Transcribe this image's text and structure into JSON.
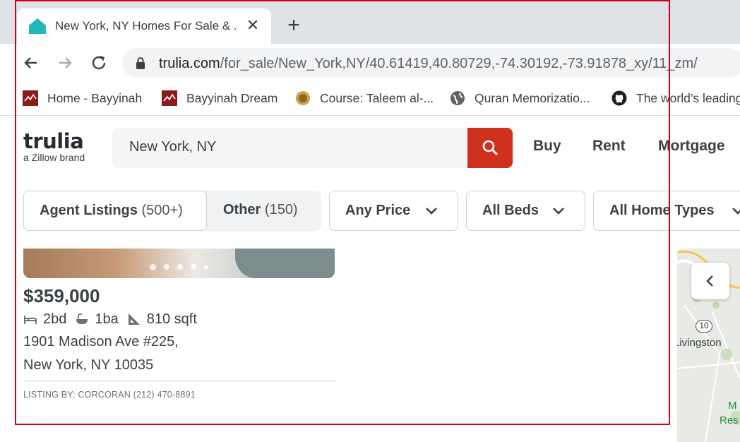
{
  "browser": {
    "tab_title": "New York, NY Homes For Sale & ...",
    "tab_close_icon": "close-icon",
    "new_tab_icon": "plus-icon",
    "url_domain": "trulia.com",
    "url_path": "/for_sale/New_York,NY/40.61419,40.80729,-74.30192,-73.91878_xy/11_zm/",
    "bookmarks": [
      {
        "label": "Home - Bayyinah",
        "icon": "bayyinah-icon"
      },
      {
        "label": "Bayyinah Dream",
        "icon": "bayyinah-icon"
      },
      {
        "label": "Course: Taleem al-...",
        "icon": "coin-icon"
      },
      {
        "label": "Quran Memorizatio...",
        "icon": "globe-icon"
      },
      {
        "label": "The world’s leading",
        "icon": "github-icon"
      }
    ]
  },
  "header": {
    "logo": "trulia",
    "logo_sub": "a Zillow brand",
    "search_value": "New York, NY",
    "nav": [
      "Buy",
      "Rent",
      "Mortgage"
    ]
  },
  "filters": {
    "agent_label": "Agent Listings",
    "agent_count": "(500+)",
    "other_label": "Other",
    "other_count": "(150)",
    "price": "Any Price",
    "beds": "All Beds",
    "home_types": "All Home Types"
  },
  "listing": {
    "price": "$359,000",
    "beds": "2bd",
    "baths": "1ba",
    "sqft": "810 sqft",
    "address_line1": "1901 Madison Ave #225,",
    "address_line2": "New York, NY 10035",
    "listing_by": "LISTING BY: CORCORAN (212) 470-8891",
    "photo_count": 5
  },
  "map": {
    "route": "10",
    "place": "Livingston",
    "label_m": "M",
    "label_res": "Res"
  },
  "colors": {
    "accent_red": "#d0311e",
    "annotation": "#d0021b",
    "favicon": "#3dbfbf"
  }
}
